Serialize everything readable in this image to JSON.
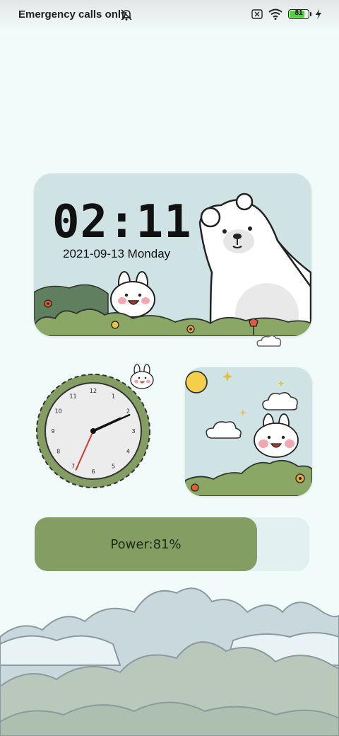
{
  "status_bar": {
    "carrier_text": "Emergency calls only",
    "battery_level": 81,
    "battery_text": "81",
    "icons": [
      "bell-off-icon",
      "sim-missing-icon",
      "wifi-icon",
      "battery-icon",
      "charging-bolt-icon"
    ]
  },
  "clock_widget": {
    "time": "02:11",
    "date": "2021-09-13 Monday"
  },
  "analog_clock": {
    "hours": 2,
    "minutes": 11,
    "numerals": [
      "12",
      "1",
      "2",
      "3",
      "4",
      "5",
      "6",
      "7",
      "8",
      "9",
      "10",
      "11"
    ]
  },
  "power_widget": {
    "label": "Power",
    "separator": ":",
    "value_text": "81%",
    "level": 0.81
  },
  "colors": {
    "background": "#f1fbfa",
    "widget_bg": "#cfe3e4",
    "accent_green": "#849d63",
    "battery_green": "#4fd13d"
  }
}
